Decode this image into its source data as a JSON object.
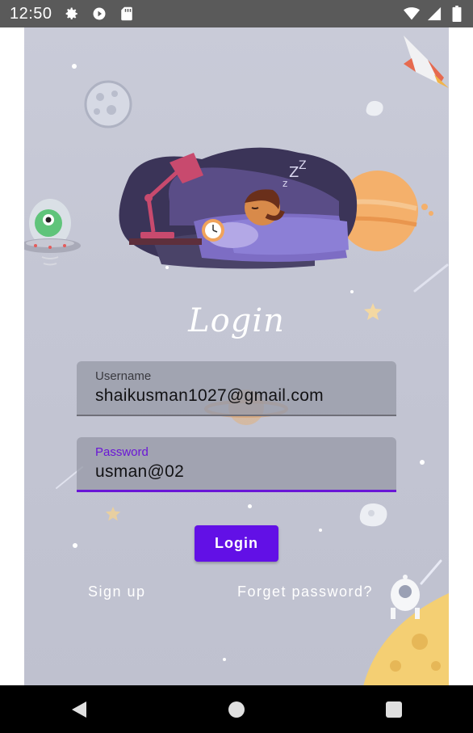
{
  "status_bar": {
    "time": "12:50",
    "left_icons": [
      "settings-icon",
      "play-protect-icon",
      "sd-card-icon"
    ],
    "right_icons": [
      "wifi-icon",
      "cell-signal-icon",
      "battery-icon"
    ]
  },
  "login": {
    "title": "Login",
    "username_label": "Username",
    "username_value": "shaikusman1027@gmail.com",
    "password_label": "Password",
    "password_value": "usman@02",
    "button_label": "Login",
    "signup_link": "Sign up",
    "forget_link": "Forget password?"
  },
  "nav_bar": {
    "icons": [
      "back-icon",
      "home-icon",
      "recents-icon"
    ]
  },
  "colors": {
    "accent": "#6210e6",
    "focused_underline": "#6a16d6",
    "status_bar": "#5a5a5a",
    "nav_bar": "#000000",
    "background": "#c6c8d6"
  }
}
